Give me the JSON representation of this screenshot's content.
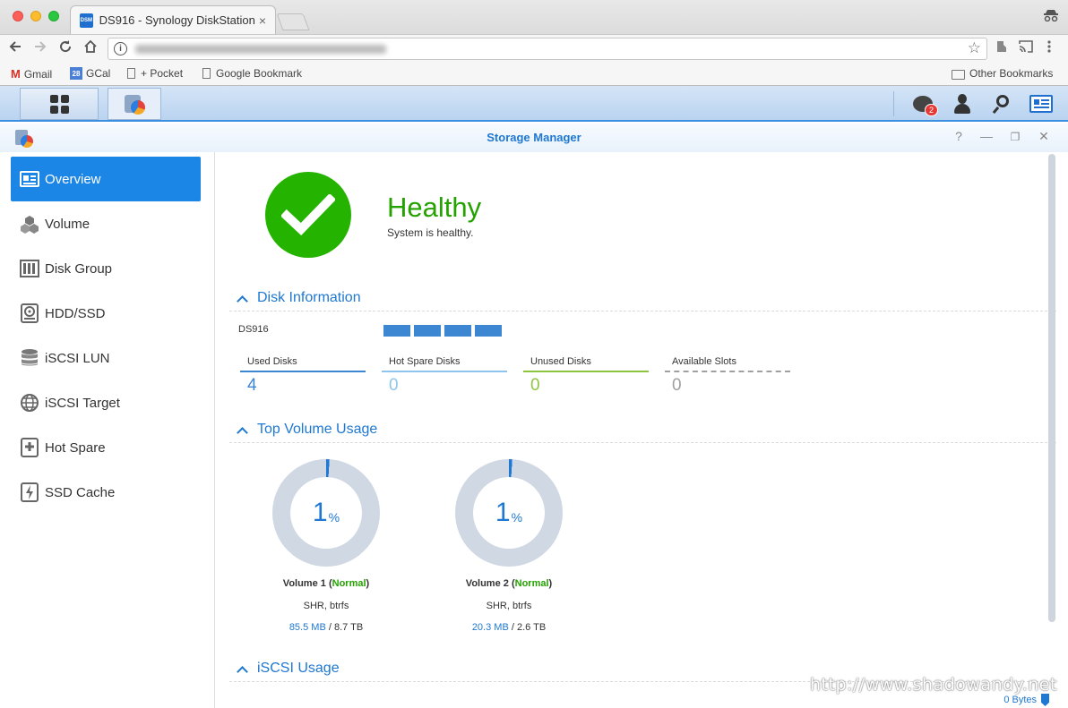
{
  "browser": {
    "tab_title": "DS916 - Synology DiskStation",
    "tab_favicon_text": "DSM",
    "tab_close": "×",
    "bookmarks": [
      {
        "label": "Gmail",
        "icon": "gmail-icon"
      },
      {
        "label": "GCal",
        "icon": "calendar-icon",
        "icon_text": "28"
      },
      {
        "label": "+ Pocket",
        "icon": "page-icon"
      },
      {
        "label": "Google Bookmark",
        "icon": "page-icon"
      }
    ],
    "other_bookmarks": "Other Bookmarks"
  },
  "taskbar": {
    "notification_count": "2"
  },
  "window": {
    "title": "Storage Manager",
    "controls": [
      "?",
      "—",
      "❐",
      "✕"
    ]
  },
  "sidebar": {
    "items": [
      {
        "label": "Overview",
        "icon": "overview-icon",
        "active": true
      },
      {
        "label": "Volume",
        "icon": "volume-icon"
      },
      {
        "label": "Disk Group",
        "icon": "disk-group-icon"
      },
      {
        "label": "HDD/SSD",
        "icon": "hdd-icon"
      },
      {
        "label": "iSCSI LUN",
        "icon": "iscsi-lun-icon"
      },
      {
        "label": "iSCSI Target",
        "icon": "iscsi-target-icon"
      },
      {
        "label": "Hot Spare",
        "icon": "hot-spare-icon"
      },
      {
        "label": "SSD Cache",
        "icon": "ssd-cache-icon"
      }
    ]
  },
  "health": {
    "status": "Healthy",
    "message": "System is healthy.",
    "color": "#24b400"
  },
  "disk_info": {
    "heading": "Disk Information",
    "device": "DS916",
    "slot_count": 4,
    "stats": [
      {
        "label": "Used Disks",
        "value": "4",
        "color": "#3d86d1"
      },
      {
        "label": "Hot Spare Disks",
        "value": "0",
        "color": "#8fc4ec"
      },
      {
        "label": "Unused Disks",
        "value": "0",
        "color": "#8cc63f"
      },
      {
        "label": "Available Slots",
        "value": "0",
        "color": "#a0a0a0"
      }
    ]
  },
  "volume_usage": {
    "heading": "Top Volume Usage",
    "volumes": [
      {
        "name": "Volume 1",
        "status": "Normal",
        "percent": "1",
        "percent_sign": "%",
        "type": "SHR, btrfs",
        "used": "85.5 MB",
        "total": "8.7 TB"
      },
      {
        "name": "Volume 2",
        "status": "Normal",
        "percent": "1",
        "percent_sign": "%",
        "type": "SHR, btrfs",
        "used": "20.3 MB",
        "total": "2.6 TB"
      }
    ]
  },
  "iscsi_usage": {
    "heading": "iSCSI Usage",
    "value": "0 Bytes"
  },
  "watermark": "http://www.shadowandy.net",
  "accent": "#1f78d1"
}
